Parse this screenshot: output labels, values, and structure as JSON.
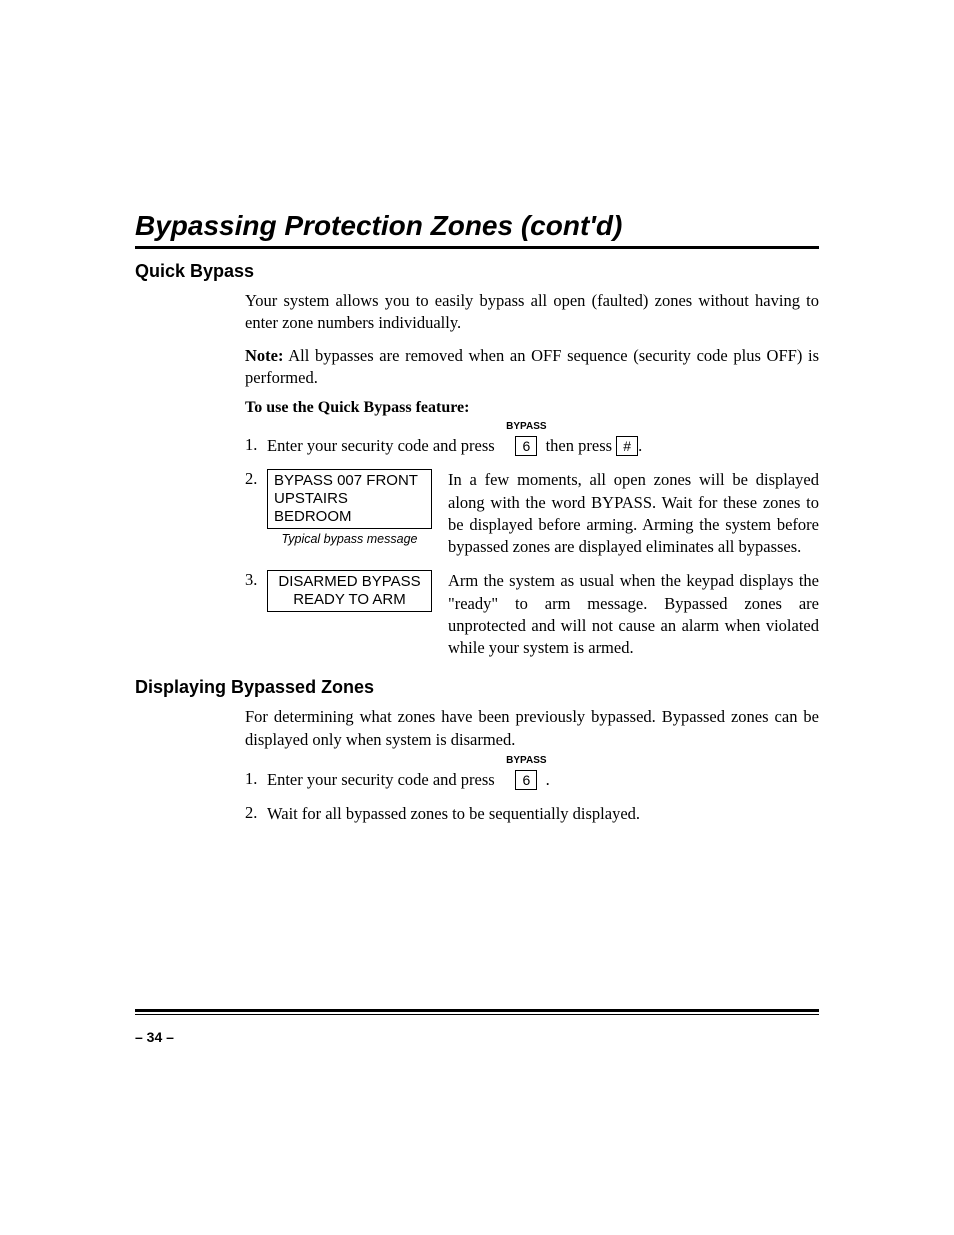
{
  "title": "Bypassing Protection Zones (cont'd)",
  "sections": {
    "quick": {
      "heading": "Quick Bypass",
      "intro": "Your system allows you to easily bypass all open (faulted) zones without having to enter zone numbers individually.",
      "note_label": "Note:",
      "note_body": " All bypasses are removed when an OFF sequence (security code plus OFF) is performed.",
      "lead": "To use the Quick Bypass feature:",
      "step1": {
        "num": "1.",
        "text_a": "Enter your security code and press",
        "key_label": "BYPASS",
        "key1": "6",
        "mid": "then press",
        "key2": "#",
        "end": "."
      },
      "step2": {
        "num": "2.",
        "display_line1": "BYPASS  007 FRONT",
        "display_line2": "UPSTAIRS BEDROOM",
        "caption": "Typical bypass message",
        "text": "In a few moments, all open zones will be displayed along with the word BYPASS. Wait for these zones to be displayed before arming. Arming the system before bypassed zones are displayed eliminates all bypasses."
      },
      "step3": {
        "num": "3.",
        "display_line1": "DISARMED BYPASS",
        "display_line2": "READY TO ARM",
        "text": "Arm the system as usual when the keypad displays the \"ready\" to arm message. Bypassed zones are unprotected and will not cause an alarm when violated while your system is armed."
      }
    },
    "display": {
      "heading": "Displaying Bypassed Zones",
      "intro": "For determining what zones have been previously bypassed. Bypassed zones can be displayed only when system is disarmed.",
      "step1": {
        "num": "1.",
        "text_a": "Enter your security code and press",
        "key_label": "BYPASS",
        "key1": "6",
        "end": "."
      },
      "step2": {
        "num": "2.",
        "text": "Wait for all bypassed zones to be sequentially displayed."
      }
    }
  },
  "page_number": "– 34 –"
}
